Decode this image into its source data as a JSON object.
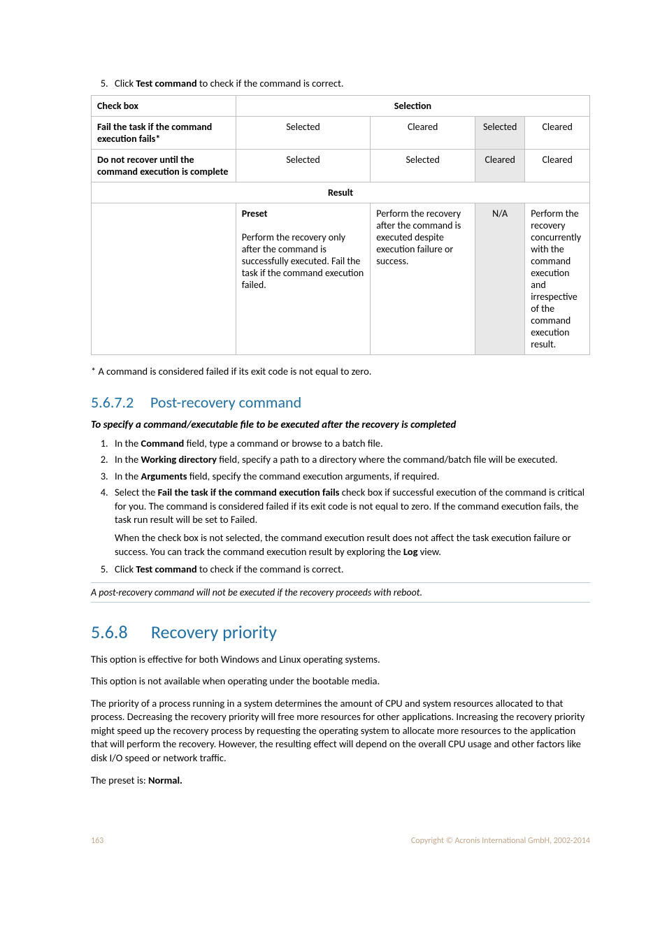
{
  "step5_top": {
    "prefix": "Click ",
    "bold": "Test command",
    "suffix": " to check if the command is correct."
  },
  "table1": {
    "head": {
      "c0": "Check box",
      "c1": "Selection"
    },
    "r1": {
      "c0": "Fail the task if the command execution fails*",
      "c1": "Selected",
      "c2": "Cleared",
      "c3": "Selected",
      "c4": "Cleared"
    },
    "r2": {
      "c0": "Do not recover until the command execution is complete",
      "c1": "Selected",
      "c2": "Selected",
      "c3": "Cleared",
      "c4": "Cleared"
    },
    "resultHead": "Result",
    "r3": {
      "c1_bold": "Preset",
      "c1_rest": "Perform the recovery only after the command is successfully executed. Fail the task if the command execution failed.",
      "c2": "Perform the recovery after the command is executed despite execution failure or success.",
      "c3": "N/A",
      "c4": "Perform the recovery concurrently with the command execution and irrespective of the command execution result."
    }
  },
  "asterisk": "* A command is considered failed if its exit code is not equal to zero.",
  "h3": {
    "num": "5.6.7.2",
    "title": "Post-recovery command"
  },
  "lead": "To specify a command/executable file to be executed after the recovery is completed",
  "steps": {
    "s1": {
      "a": "In the ",
      "b": "Command",
      "c": " field, type a command or browse to a batch file."
    },
    "s2": {
      "a": "In the ",
      "b": "Working directory",
      "c": " field, specify a path to a directory where the command/batch file will be executed."
    },
    "s3": {
      "a": "In the ",
      "b": "Arguments",
      "c": " field, specify the command execution arguments, if required."
    },
    "s4": {
      "a": "Select the ",
      "b": "Fail the task if the command execution fails",
      "c": " check box if successful execution of the command is critical for you. The command is considered failed if its exit code is not equal to zero. If the command execution fails, the task run result will be set to Failed."
    },
    "s4b": {
      "a": "When the check box is not selected, the command execution result does not affect the task execution failure or success. You can track the command execution result by exploring the ",
      "b": "Log",
      "c": " view."
    },
    "s5": {
      "a": "Click ",
      "b": "Test command",
      "c": " to check if the command is correct."
    }
  },
  "note": "A post-recovery command will not be executed if the recovery proceeds with reboot.",
  "h2": {
    "num": "5.6.8",
    "title": "Recovery priority"
  },
  "p1": "This option is effective for both Windows and Linux operating systems.",
  "p2": "This option is not available when operating under the bootable media.",
  "p3": "The priority of a process running in a system determines the amount of CPU and system resources allocated to that process. Decreasing the recovery priority will free more resources for other applications. Increasing the recovery priority might speed up the recovery process by requesting the operating system to allocate more resources to the application that will perform the recovery. However, the resulting effect will depend on the overall CPU usage and other factors like disk I/O speed or network traffic.",
  "p4": {
    "a": "The preset is: ",
    "b": "Normal."
  },
  "footer": {
    "page": "163",
    "copyright": "Copyright © Acronis International GmbH, 2002-2014"
  }
}
